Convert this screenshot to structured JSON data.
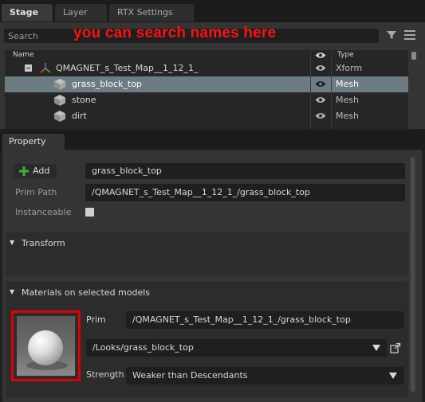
{
  "tabs": [
    {
      "label": "Stage"
    },
    {
      "label": "Layer"
    },
    {
      "label": "RTX Settings"
    }
  ],
  "stage": {
    "search_placeholder": "Search",
    "annotation": "you can search names here",
    "columns": {
      "name": "Name",
      "type": "Type"
    },
    "rows": [
      {
        "label": "QMAGNET_s_Test_Map__1_12_1_",
        "type": "Xform",
        "selected": false
      },
      {
        "label": "grass_block_top",
        "type": "Mesh",
        "selected": true
      },
      {
        "label": "stone",
        "type": "Mesh",
        "selected": false
      },
      {
        "label": "dirt",
        "type": "Mesh",
        "selected": false
      }
    ]
  },
  "property": {
    "tab_label": "Property",
    "add_label": "Add",
    "name_value": "grass_block_top",
    "prim_path_label": "Prim Path",
    "prim_path_value": "/QMAGNET_s_Test_Map__1_12_1_/grass_block_top",
    "instanceable_label": "Instanceable",
    "transform_title": "Transform",
    "materials_title": "Materials on selected models",
    "prim_label": "Prim",
    "prim_value": "/QMAGNET_s_Test_Map__1_12_1_/grass_block_top",
    "material_value": "/Looks/grass_block_top",
    "strength_label": "Strength",
    "strength_value": "Weaker than Descendants"
  },
  "colors": {
    "selection": "#6d7b82",
    "annotation": "#ff1010",
    "add_icon": "#3fae3f"
  }
}
